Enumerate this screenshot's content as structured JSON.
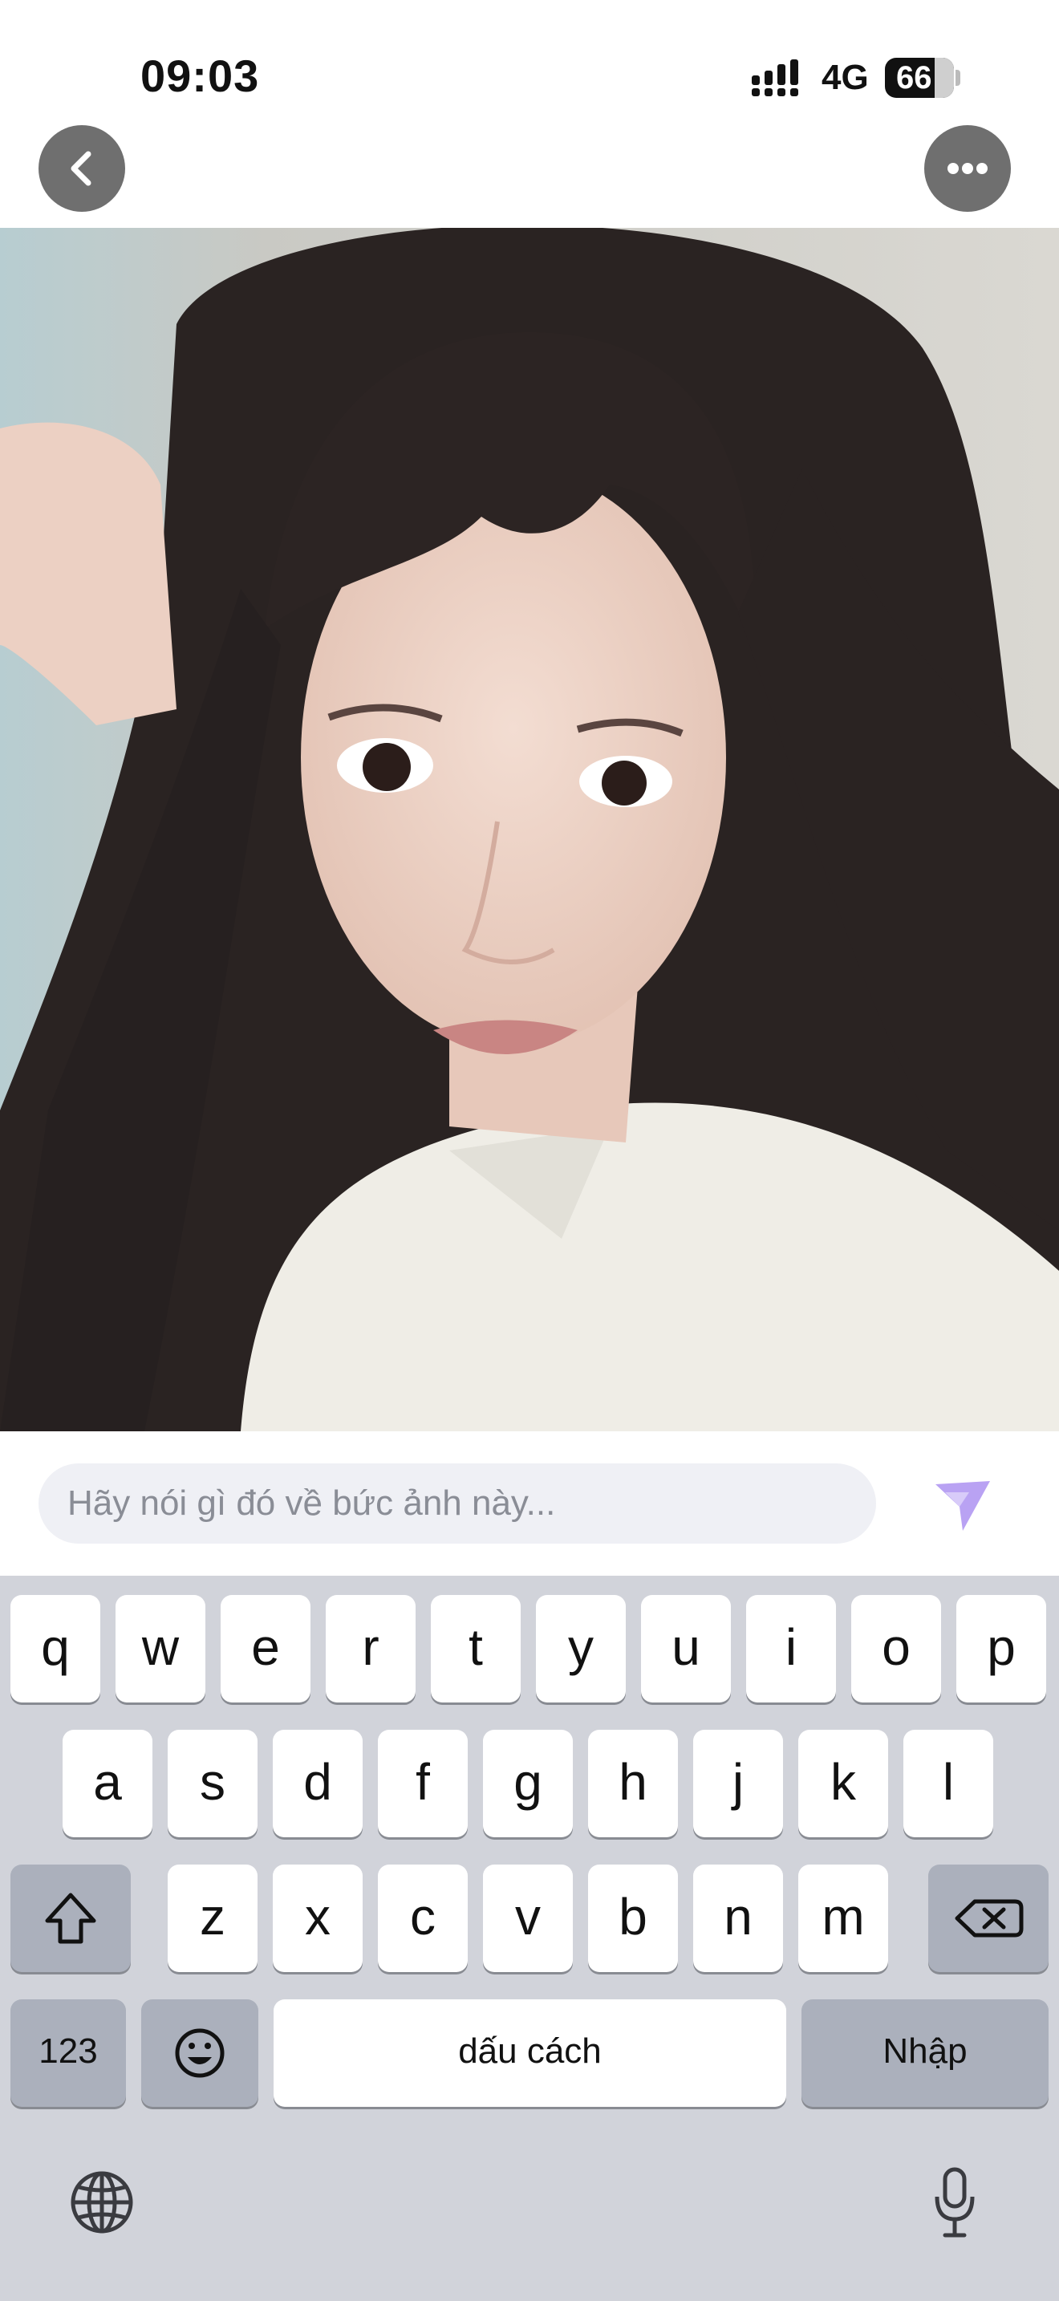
{
  "status_bar": {
    "time": "09:03",
    "network": "4G",
    "battery": "66"
  },
  "nav": {
    "back_icon": "chevron-left-icon",
    "more_icon": "ellipsis-icon"
  },
  "photo": {
    "subject": "selfie-photo"
  },
  "comment": {
    "placeholder": "Hãy nói gì đó về bức ảnh này...",
    "value": ""
  },
  "send": {
    "icon": "send-icon",
    "color": "#b9a2f3"
  },
  "keyboard": {
    "row1": [
      "q",
      "w",
      "e",
      "r",
      "t",
      "y",
      "u",
      "i",
      "o",
      "p"
    ],
    "row2": [
      "a",
      "s",
      "d",
      "f",
      "g",
      "h",
      "j",
      "k",
      "l"
    ],
    "row3": [
      "z",
      "x",
      "c",
      "v",
      "b",
      "n",
      "m"
    ],
    "numbers_label": "123",
    "space_label": "dấu cách",
    "return_label": "Nhập",
    "shift_icon": "shift-icon",
    "delete_icon": "backspace-icon",
    "emoji_icon": "emoji-icon",
    "globe_icon": "globe-icon",
    "mic_icon": "microphone-icon"
  }
}
